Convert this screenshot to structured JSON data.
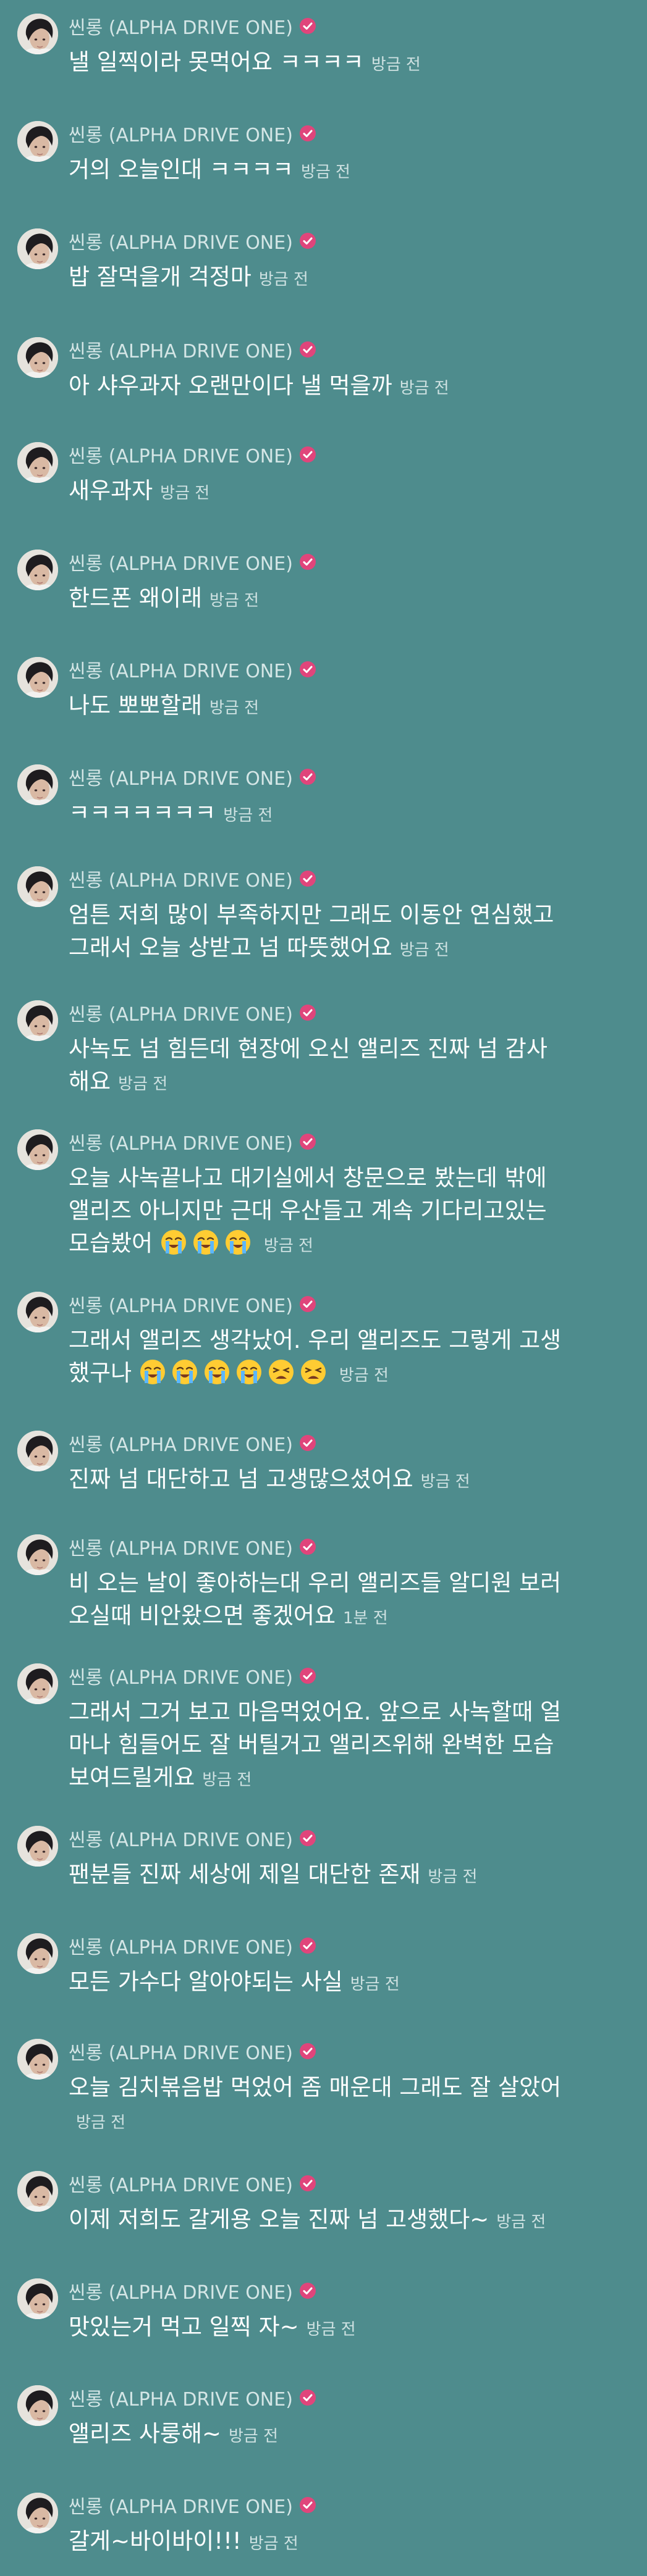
{
  "author_name": "씬롱 (ALPHA DRIVE ONE)",
  "colors": {
    "background": "#4e8c8d",
    "verified_badge": "#e0457b",
    "text": "#ffffff",
    "meta_text": "#cfe2e2"
  },
  "icons": {
    "verified": "verified-badge-icon",
    "emoji_loudly_crying": "loudly-crying-face-emoji",
    "emoji_tired": "tired-face-emoji"
  },
  "messages": [
    {
      "lines": [
        "낼 일찍이라 못먹어요 ㅋㅋㅋㅋ"
      ],
      "time": "방금 전"
    },
    {
      "lines": [
        "거의 오늘인대 ㅋㅋㅋㅋ"
      ],
      "time": "방금 전"
    },
    {
      "lines": [
        "밥 잘먹을개 걱정마"
      ],
      "time": "방금 전"
    },
    {
      "lines": [
        "아 샤우과자 오랜만이다 낼 먹을까"
      ],
      "time": "방금 전"
    },
    {
      "lines": [
        "새우과자"
      ],
      "time": "방금 전"
    },
    {
      "lines": [
        "한드폰 왜이래"
      ],
      "time": "방금 전"
    },
    {
      "lines": [
        "나도 뽀뽀할래"
      ],
      "time": "방금 전"
    },
    {
      "lines": [
        "ㅋㅋㅋㅋㅋㅋㅋ"
      ],
      "time": "방금 전"
    },
    {
      "lines": [
        "엄튼 저희 많이 부족하지만 그래도 이동안 연심했고",
        "그래서 오늘 상받고 넘 따뜻했어요"
      ],
      "time": "방금 전"
    },
    {
      "lines": [
        "사녹도 넘 힘든데 현장에 오신 앨리즈 진짜 넘 감사",
        "해요"
      ],
      "time": "방금 전"
    },
    {
      "lines": [
        "오늘 사녹끝나고 대기실에서 창문으로 봤는데 밖에",
        "앨리즈 아니지만 근대 우산들고 계속 기다리고있는",
        "모습봤어"
      ],
      "time": "방금 전",
      "emojis": [
        "loudly-crying",
        "loudly-crying",
        "loudly-crying"
      ]
    },
    {
      "lines": [
        "그래서 앨리즈 생각났어. 우리 앨리즈도 그렇게 고생",
        "했구나"
      ],
      "time": "방금 전",
      "emojis": [
        "loudly-crying",
        "loudly-crying",
        "loudly-crying",
        "loudly-crying",
        "tired",
        "tired"
      ]
    },
    {
      "lines": [
        "진짜 넘 대단하고 넘 고생많으셨어요"
      ],
      "time": "방금 전"
    },
    {
      "lines": [
        "비 오는 날이 좋아하는대 우리 앨리즈들 알디원 보러",
        "오실때 비안왔으면 좋겠어요"
      ],
      "time": "1분 전"
    },
    {
      "lines": [
        "그래서 그거 보고 마음먹었어요. 앞으로 사녹할때 얼",
        "마나 힘들어도 잘 버틸거고 앨리즈위해 완벽한 모습",
        "보여드릴게요"
      ],
      "time": "방금 전"
    },
    {
      "lines": [
        "팬분들 진짜 세상에 제일 대단한 존재"
      ],
      "time": "방금 전"
    },
    {
      "lines": [
        "모든 가수다 알아야되는 사실"
      ],
      "time": "방금 전"
    },
    {
      "lines": [
        "오늘 김치볶음밥 먹었어 좀 매운대 그래도 잘 살았어"
      ],
      "time": "방금 전",
      "time_own_line": true
    },
    {
      "lines": [
        "이제 저희도 갈게용 오늘 진짜 넘 고생했다~"
      ],
      "time": "방금 전"
    },
    {
      "lines": [
        "맛있는거 먹고 일찍 자~"
      ],
      "time": "방금 전"
    },
    {
      "lines": [
        "앨리즈 사룽해~"
      ],
      "time": "방금 전"
    },
    {
      "lines": [
        "갈게~바이바이!!!"
      ],
      "time": "방금 전"
    }
  ]
}
